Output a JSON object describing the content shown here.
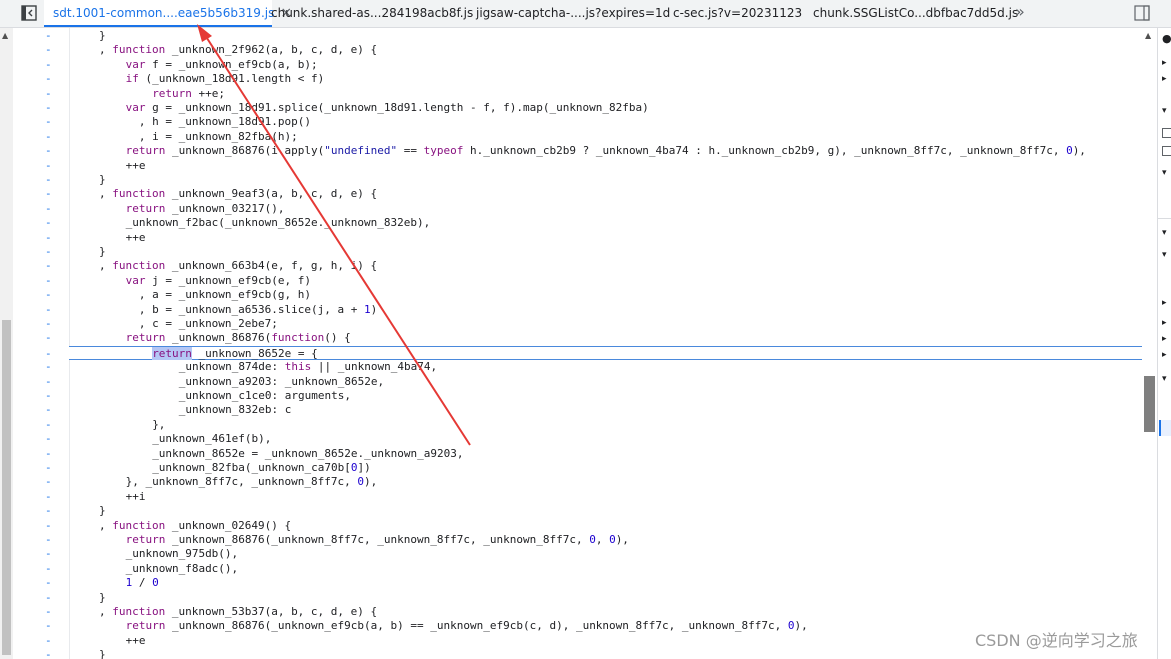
{
  "tabs": [
    {
      "label": "sdt.1001-common....eae5b56b319.js",
      "active": true
    },
    {
      "label": "chunk.shared-as...284198acb8f.js",
      "active": false
    },
    {
      "label": "jigsaw-captcha-....js?expires=1d",
      "active": false
    },
    {
      "label": "c-sec.js?v=20231123",
      "active": false
    },
    {
      "label": "chunk.SSGListCo...dbfbac7dd5d.js",
      "active": false
    }
  ],
  "tab_close_glyph": "×",
  "more_tabs_glyph": "»",
  "gutter_mark": "-",
  "code_lines": [
    {
      "text": "}",
      "indent": 2
    },
    {
      "text": ", function _unknown_2f962(a, b, c, d, e) {",
      "indent": 2
    },
    {
      "text": "var f = _unknown_ef9cb(a, b);",
      "indent": 3
    },
    {
      "text": "if (_unknown_18d91.length < f)",
      "indent": 3
    },
    {
      "text": "return ++e;",
      "indent": 4
    },
    {
      "text": "var g = _unknown_18d91.splice(_unknown_18d91.length - f, f).map(_unknown_82fba)",
      "indent": 3
    },
    {
      "text": "  , h = _unknown_18d91.pop()",
      "indent": 3
    },
    {
      "text": "  , i = _unknown_82fba(h);",
      "indent": 3
    },
    {
      "text": "return _unknown_86876(i.apply(\"undefined\" == typeof h._unknown_cb2b9 ? _unknown_4ba74 : h._unknown_cb2b9, g), _unknown_8ff7c, _unknown_8ff7c, 0),",
      "indent": 3
    },
    {
      "text": "++e",
      "indent": 3
    },
    {
      "text": "}",
      "indent": 2
    },
    {
      "text": ", function _unknown_9eaf3(a, b, c, d, e) {",
      "indent": 2
    },
    {
      "text": "return _unknown_03217(),",
      "indent": 3
    },
    {
      "text": "_unknown_f2bac(_unknown_8652e._unknown_832eb),",
      "indent": 3
    },
    {
      "text": "++e",
      "indent": 3
    },
    {
      "text": "}",
      "indent": 2
    },
    {
      "text": ", function _unknown_663b4(e, f, g, h, i) {",
      "indent": 2
    },
    {
      "text": "var j = _unknown_ef9cb(e, f)",
      "indent": 3
    },
    {
      "text": "  , a = _unknown_ef9cb(g, h)",
      "indent": 3
    },
    {
      "text": "  , b = _unknown_a6536.slice(j, a + 1)",
      "indent": 3
    },
    {
      "text": "  , c = _unknown_2ebe7;",
      "indent": 3
    },
    {
      "text": "return _unknown_86876(function() {",
      "indent": 3
    },
    {
      "text": "return _unknown_8652e = {",
      "indent": 4,
      "current": true
    },
    {
      "text": "_unknown_874de: this || _unknown_4ba74,",
      "indent": 5
    },
    {
      "text": "_unknown_a9203: _unknown_8652e,",
      "indent": 5
    },
    {
      "text": "_unknown_c1ce0: arguments,",
      "indent": 5
    },
    {
      "text": "_unknown_832eb: c",
      "indent": 5
    },
    {
      "text": "},",
      "indent": 4
    },
    {
      "text": "_unknown_461ef(b),",
      "indent": 4
    },
    {
      "text": "_unknown_8652e = _unknown_8652e._unknown_a9203,",
      "indent": 4
    },
    {
      "text": "_unknown_82fba(_unknown_ca70b[0])",
      "indent": 4
    },
    {
      "text": "}, _unknown_8ff7c, _unknown_8ff7c, 0),",
      "indent": 3
    },
    {
      "text": "++i",
      "indent": 3
    },
    {
      "text": "}",
      "indent": 2
    },
    {
      "text": ", function _unknown_02649() {",
      "indent": 2
    },
    {
      "text": "return _unknown_86876(_unknown_8ff7c, _unknown_8ff7c, _unknown_8ff7c, 0, 0),",
      "indent": 3
    },
    {
      "text": "_unknown_975db(),",
      "indent": 3
    },
    {
      "text": "_unknown_f8adc(),",
      "indent": 3
    },
    {
      "text": "1 / 0",
      "indent": 3
    },
    {
      "text": "}",
      "indent": 2
    },
    {
      "text": ", function _unknown_53b37(a, b, c, d, e) {",
      "indent": 2
    },
    {
      "text": "return _unknown_86876(_unknown_ef9cb(a, b) == _unknown_ef9cb(c, d), _unknown_8ff7c, _unknown_8ff7c, 0),",
      "indent": 3
    },
    {
      "text": "++e",
      "indent": 3
    },
    {
      "text": "}",
      "indent": 2
    }
  ],
  "watermark": "CSDN @逆向学习之旅",
  "colors": {
    "keyword": "#881280",
    "string": "#1a1aa6",
    "number": "#1c00cf",
    "selection": "#b4c7f5",
    "arrow": "#e53935",
    "active_tab_border": "#1a73e8"
  },
  "icons": [
    "sidebar-toggle-icon",
    "close-icon",
    "more-tabs-icon",
    "right-sidebar-toggle-icon",
    "scroll-up-icon"
  ]
}
